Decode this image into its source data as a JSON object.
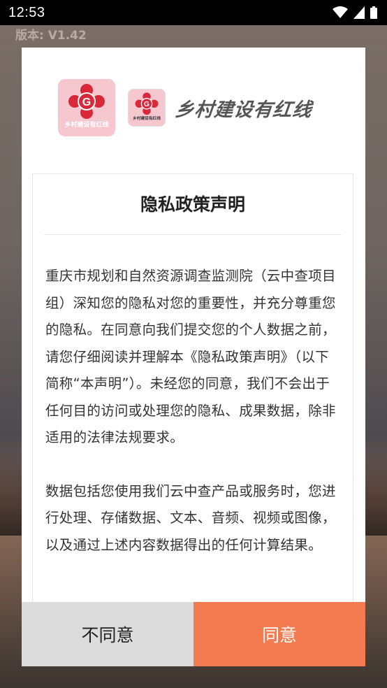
{
  "status_bar": {
    "time": "12:53"
  },
  "background": {
    "version": "版本: V1.42",
    "footer": ""
  },
  "dialog": {
    "brand": {
      "title": "乡村建设有红线"
    },
    "logo": {
      "line1": "土",
      "line2": "调",
      "line3": "国",
      "line4": "云",
      "line5": "查",
      "badge": "G",
      "caption": "乡村建设有红线"
    },
    "title": "隐私政策声明",
    "paragraphs": [
      "重庆市规划和自然资源调查监测院（云中查项目组）深知您的隐私对您的重要性，并充分尊重您的隐私。在同意向我们提交您的个人数据之前，请您仔细阅读并理解本《隐私政策声明》（以下简称“本声明”）。未经您的同意，我们不会出于任何目的访问或处理您的隐私、成果数据，除非适用的法律法规要求。",
      "数据包括您使用我们云中查产品或服务时，您进行处理、存储数据、文本、音频、视频或图像，以及通过上述内容数据得出的任何计算结果。"
    ],
    "buttons": {
      "disagree": "不同意",
      "agree": "同意"
    }
  },
  "colors": {
    "agree": "#f37b4f",
    "disagree": "#dcdcdc",
    "logo_bg": "#f6c7cf",
    "logo_red": "#d9283a"
  },
  "icons": [
    "wifi-icon",
    "signal-icon",
    "battery-icon"
  ]
}
